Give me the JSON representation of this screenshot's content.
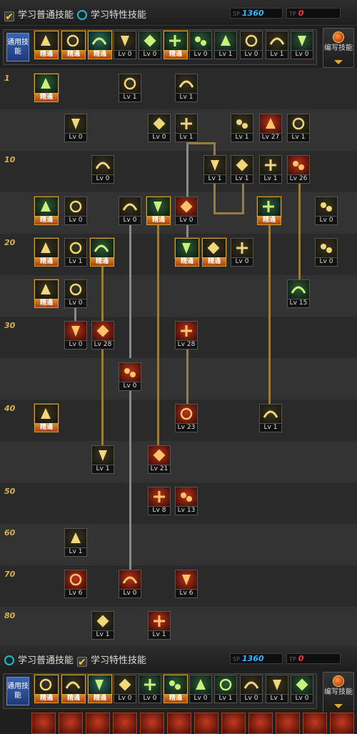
{
  "header": {
    "mode_common_label": "学习普通技能",
    "mode_trait_label": "学习特性技能",
    "sp_label": "SP",
    "sp_value": "1360",
    "tp_label": "TP",
    "tp_value": "0",
    "sp_color": "#34b6ff",
    "tp_color": "#ff3a2a"
  },
  "common": {
    "label": "通用技能",
    "sort_label": "编写技能",
    "skills": [
      {
        "lv": "精通"
      },
      {
        "lv": "精通"
      },
      {
        "lv": "精通"
      },
      {
        "lv": "Lv 0"
      },
      {
        "lv": "Lv 0"
      },
      {
        "lv": "精通"
      },
      {
        "lv": "Lv 0"
      },
      {
        "lv": "Lv 1"
      },
      {
        "lv": "Lv 0"
      },
      {
        "lv": "Lv 1"
      },
      {
        "lv": "Lv 0"
      }
    ]
  },
  "tree": {
    "level_markers": [
      "1",
      "10",
      "20",
      "30",
      "40",
      "50",
      "60",
      "70",
      "80"
    ],
    "skills": [
      {
        "lv": "精通"
      },
      {
        "lv": "Lv 1"
      },
      {
        "lv": "Lv 1"
      },
      {
        "lv": "Lv 0"
      },
      {
        "lv": "Lv 0"
      },
      {
        "lv": "Lv 1"
      },
      {
        "lv": "Lv 1"
      },
      {
        "lv": "Lv 27"
      },
      {
        "lv": "Lv 1"
      },
      {
        "lv": "Lv 0"
      },
      {
        "lv": "Lv 1"
      },
      {
        "lv": "Lv 1"
      },
      {
        "lv": "Lv 1"
      },
      {
        "lv": "Lv 26"
      },
      {
        "lv": "精通"
      },
      {
        "lv": "Lv 0"
      },
      {
        "lv": "Lv 0"
      },
      {
        "lv": "精通"
      },
      {
        "lv": "Lv 0"
      },
      {
        "lv": "精通"
      },
      {
        "lv": "Lv 0"
      },
      {
        "lv": "精通"
      },
      {
        "lv": "Lv 1"
      },
      {
        "lv": "精通"
      },
      {
        "lv": "精通"
      },
      {
        "lv": "精通"
      },
      {
        "lv": "Lv 0"
      },
      {
        "lv": "Lv 0"
      },
      {
        "lv": "精通"
      },
      {
        "lv": "Lv 0"
      },
      {
        "lv": "Lv 15"
      },
      {
        "lv": "Lv 0"
      },
      {
        "lv": "Lv 28"
      },
      {
        "lv": "Lv 28"
      },
      {
        "lv": "Lv 0"
      },
      {
        "lv": "精通"
      },
      {
        "lv": "Lv 23"
      },
      {
        "lv": "Lv 1"
      },
      {
        "lv": "Lv 1"
      },
      {
        "lv": "Lv 21"
      },
      {
        "lv": "Lv 8"
      },
      {
        "lv": "Lv 13"
      },
      {
        "lv": "Lv 1"
      },
      {
        "lv": "Lv 6"
      },
      {
        "lv": "Lv 0"
      },
      {
        "lv": "Lv 6"
      },
      {
        "lv": "Lv 1"
      },
      {
        "lv": "Lv 1"
      }
    ]
  }
}
